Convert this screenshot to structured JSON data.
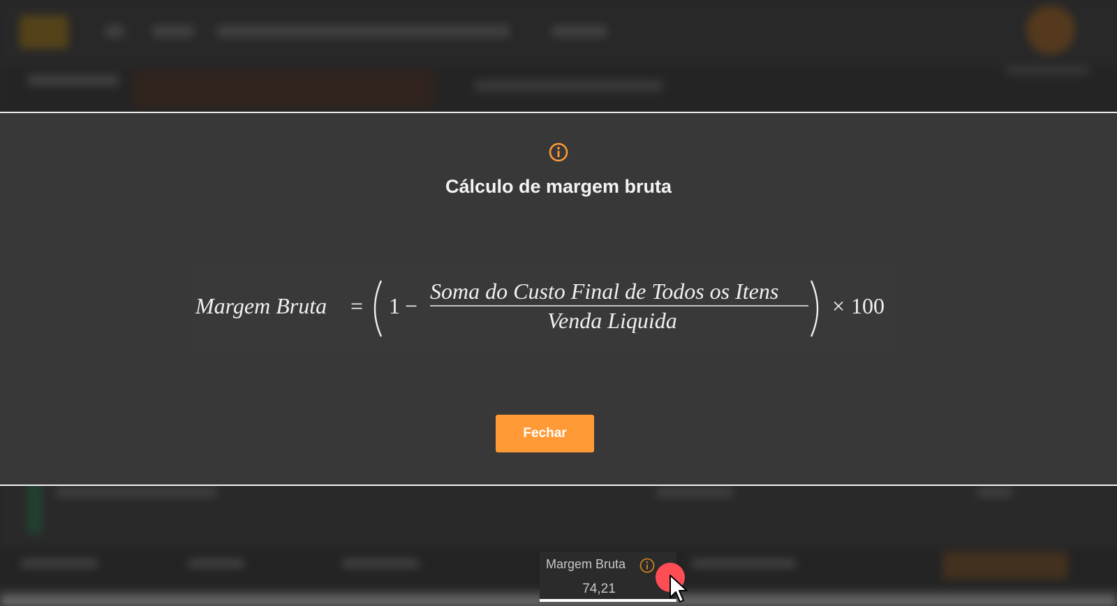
{
  "modal": {
    "title": "Cálculo de margem bruta",
    "icon": "info-circle-icon",
    "formula": {
      "lhs": "Margem Bruta",
      "equals": "=",
      "one": "1",
      "minus": "−",
      "numerator": "Soma do Custo Final de Todos os Itens",
      "denominator": "Venda Liquida",
      "times": "×",
      "hundred": "100"
    },
    "close_label": "Fechar"
  },
  "metric_card": {
    "label": "Margem Bruta",
    "value": "74,21",
    "icon": "info-circle-icon"
  },
  "colors": {
    "accent": "#ff9a36",
    "modal_bg": "#383838",
    "page_bg": "#262626"
  }
}
